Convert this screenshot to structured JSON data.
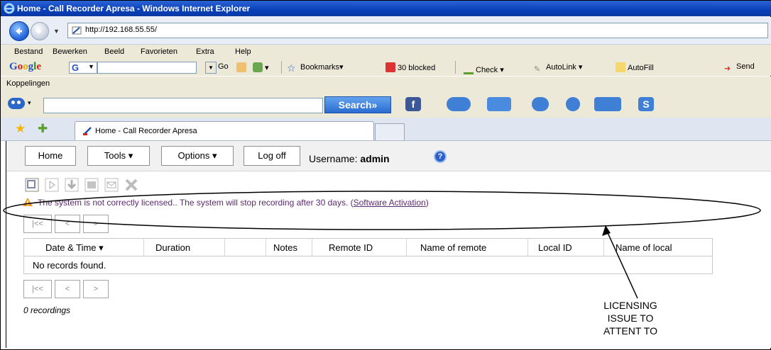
{
  "window": {
    "title": "Home - Call Recorder Apresa - Windows Internet Explorer"
  },
  "address": {
    "url": "http://192.168.55.55/"
  },
  "menu": [
    "Bestand",
    "Bewerken",
    "Beeld",
    "Favorieten",
    "Extra",
    "Help"
  ],
  "googlebar": {
    "logo": {
      "G1": "G",
      "o1": "o",
      "o2": "o",
      "g": "g",
      "l": "l",
      "e": "e"
    },
    "select_value": "G",
    "go_label": "Go",
    "bookmarks_label": "Bookmarks",
    "blocked_label": "30 blocked",
    "check_label": "Check",
    "autolink_label": "AutoLink",
    "autofill_label": "AutoFill",
    "send_label": "Send"
  },
  "links": {
    "label": "Koppelingen"
  },
  "searchbar": {
    "search_label": "Search",
    "search_arrows": "»"
  },
  "tab": {
    "title": "Home - Call Recorder Apresa"
  },
  "app": {
    "buttons": {
      "home": "Home",
      "tools": "Tools",
      "options": "Options",
      "logoff": "Log off"
    },
    "username_label": "Username:",
    "username_value": "admin",
    "warning": {
      "message": "The system is not correctly licensed.. The system will stop recording after 30 days. (",
      "link": "Software Activation",
      "suffix": ")"
    },
    "pager": {
      "first": "|<<",
      "prev": "<",
      "next": ">"
    },
    "columns": [
      "Date & Time",
      "Duration",
      "Notes",
      "Remote ID",
      "Name of remote",
      "Local ID",
      "Name of local"
    ],
    "empty_text": "No records found.",
    "count_text": "0 recordings"
  },
  "annotation": {
    "line1": "LICENSING",
    "line2": "ISSUE TO",
    "line3": "ATTENT TO"
  },
  "colors": {
    "title_bar": "#0a3fb8",
    "warning_text": "#5a2b6e",
    "annotation": "#000000"
  }
}
